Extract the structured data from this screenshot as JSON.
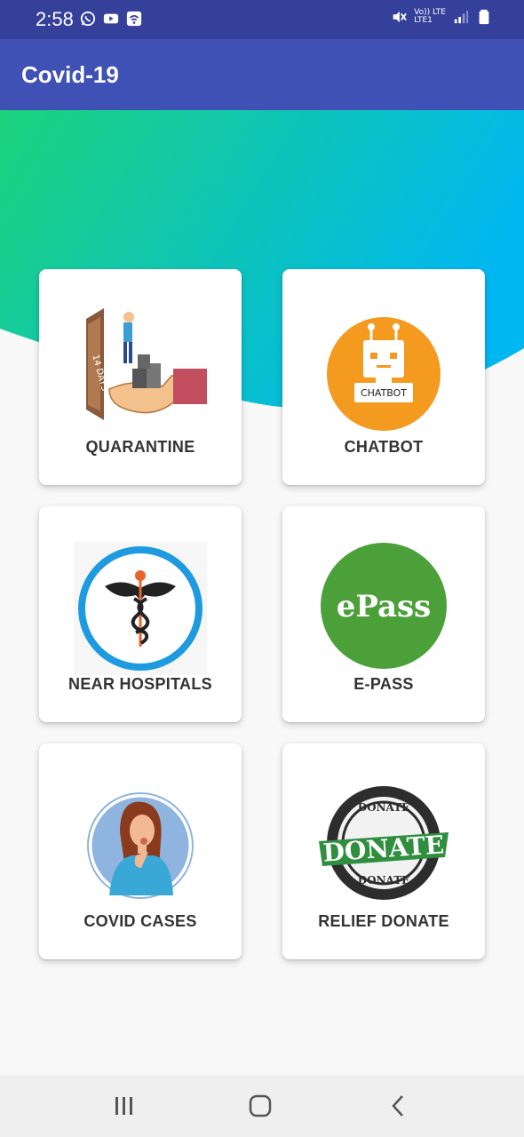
{
  "status_bar": {
    "time": "2:58",
    "left_icons": [
      "whatsapp-icon",
      "youtube-icon",
      "wifi-calling-icon"
    ],
    "right_icons": [
      "mute-icon",
      "volte-lte-icon",
      "signal-icon",
      "battery-icon"
    ],
    "network_text_top": "Vo)) LTE",
    "network_text_bottom": "LTE1"
  },
  "app_bar": {
    "title": "Covid-19"
  },
  "theme": {
    "primary": "#3f51b5",
    "primary_dark": "#34409a",
    "gradient_start": "#1dd37c",
    "gradient_end": "#00b7f1"
  },
  "cards": [
    {
      "label": "QUARANTINE",
      "icon": "quarantine-illustration"
    },
    {
      "label": "CHATBOT",
      "icon": "chatbot-robot-icon",
      "badge": "CHATBOT"
    },
    {
      "label": "NEAR HOSPITALS",
      "icon": "caduceus-icon"
    },
    {
      "label": "E-PASS",
      "icon": "epass-icon",
      "badge": "ePass"
    },
    {
      "label": "COVID CASES",
      "icon": "sick-woman-icon"
    },
    {
      "label": "RELIEF DONATE",
      "icon": "donate-stamp-icon",
      "badge": "DONATE"
    }
  ],
  "nav_bar": {
    "buttons": [
      "recent-apps-icon",
      "home-icon",
      "back-icon"
    ]
  }
}
